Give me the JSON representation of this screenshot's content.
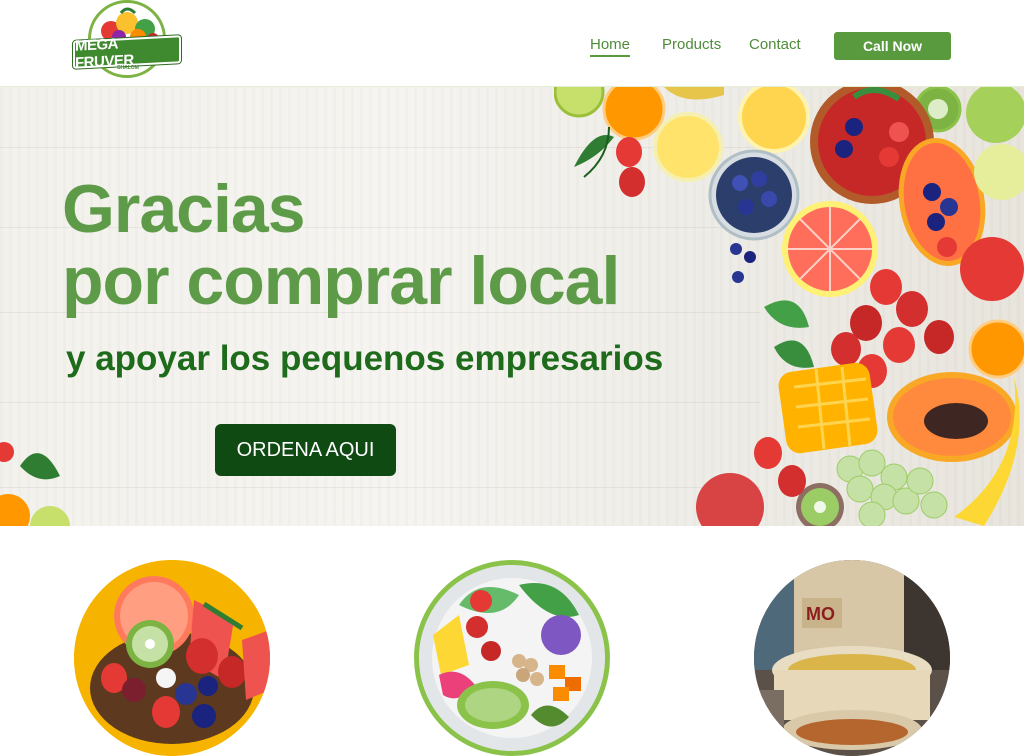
{
  "brand": {
    "name": "MEGA FRUVER",
    "tagline": "SHALOM"
  },
  "nav": {
    "items": [
      {
        "label": "Home",
        "active": true
      },
      {
        "label": "Products",
        "active": false
      },
      {
        "label": "Contact",
        "active": false
      }
    ],
    "cta_label": "Call Now"
  },
  "hero": {
    "title_line1": "Gracias",
    "title_line2": "por comprar local",
    "subtitle": "y apoyar los pequenos empresarios",
    "button_label": "ORDENA AQUI"
  },
  "products": [
    {
      "name": "fruit-bowl-image"
    },
    {
      "name": "salad-bowl-image"
    },
    {
      "name": "grain-sacks-image"
    }
  ],
  "colors": {
    "brand_green": "#5a9a3e",
    "title_green": "#5e9b48",
    "subtitle_green": "#1e6b1c",
    "button_dark_green": "#0f4a13",
    "circle1_ring": "#f6b400",
    "circle2_ring": "#8bc34a"
  }
}
